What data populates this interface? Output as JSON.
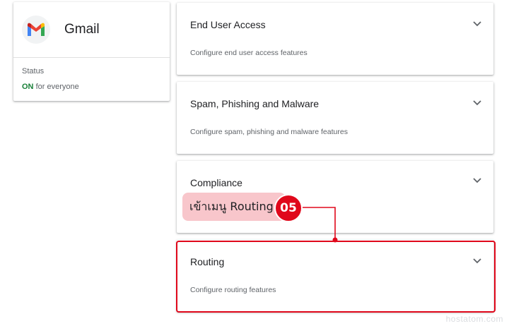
{
  "app": {
    "name": "Gmail",
    "status_label": "Status",
    "status_value": "ON",
    "status_suffix": "for everyone"
  },
  "sections": [
    {
      "title": "End User Access",
      "description": "Configure end user access features"
    },
    {
      "title": "Spam, Phishing and Malware",
      "description": "Configure spam, phishing and malware features"
    },
    {
      "title": "Compliance",
      "description": ""
    },
    {
      "title": "Routing",
      "description": "Configure routing features"
    }
  ],
  "annotation": {
    "text": "เข้าเมนู Routing",
    "step": "05"
  },
  "watermark": "hostatom.com",
  "colors": {
    "status_on": "#188038",
    "highlight": "#e0081b",
    "callout_bg": "#f8c6cb"
  }
}
